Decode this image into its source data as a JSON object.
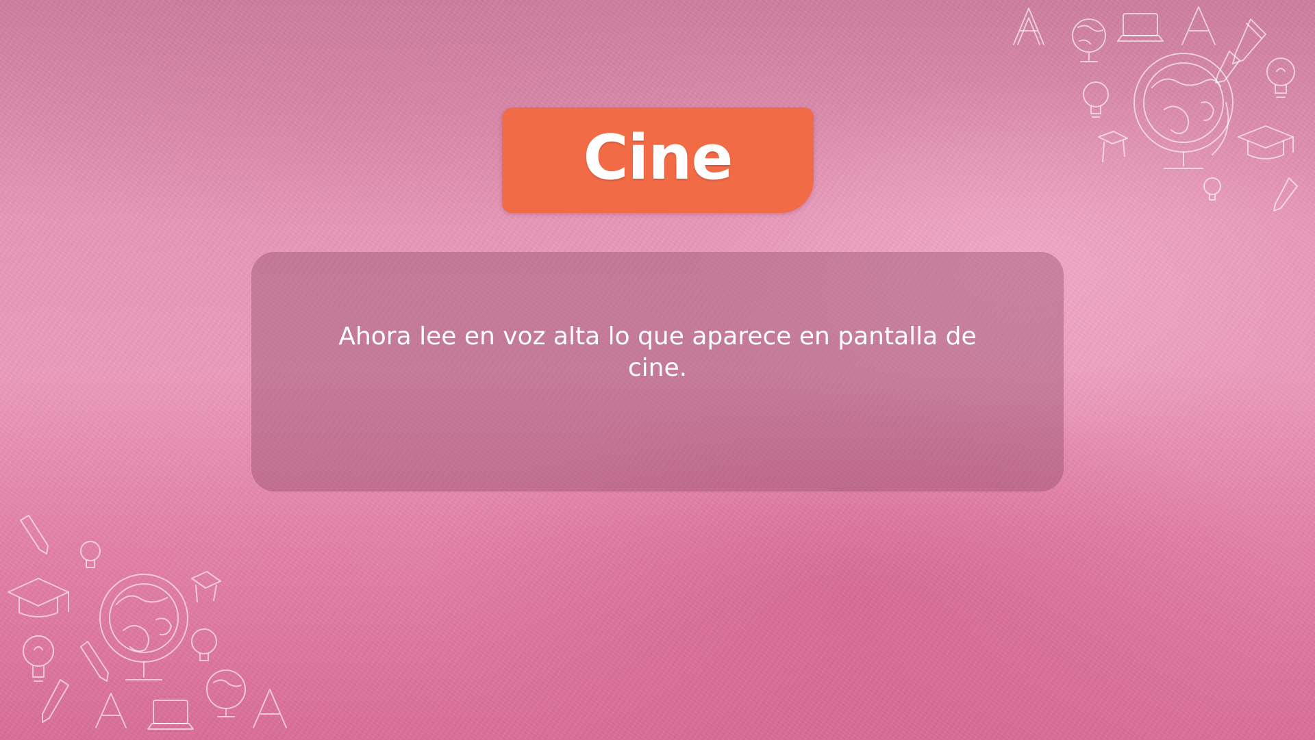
{
  "slide": {
    "title": "Cine",
    "body_text": "Ahora lee en voz alta lo que aparece en pantalla de cine.",
    "colors": {
      "background": "#e897b9",
      "title_badge": "#f26b47",
      "card": "#a86685",
      "text": "#ffffff"
    }
  },
  "decorations": {
    "top_right_icons": [
      "letter-a-icon",
      "globe-icon",
      "laptop-icon",
      "letter-a-icon",
      "pencil-icon",
      "lightbulb-icon",
      "graduation-cap-icon"
    ],
    "bottom_left_icons": [
      "pencil-icon",
      "lightbulb-icon",
      "graduation-cap-icon",
      "globe-icon",
      "letter-a-icon",
      "laptop-icon",
      "letter-a-icon"
    ]
  }
}
